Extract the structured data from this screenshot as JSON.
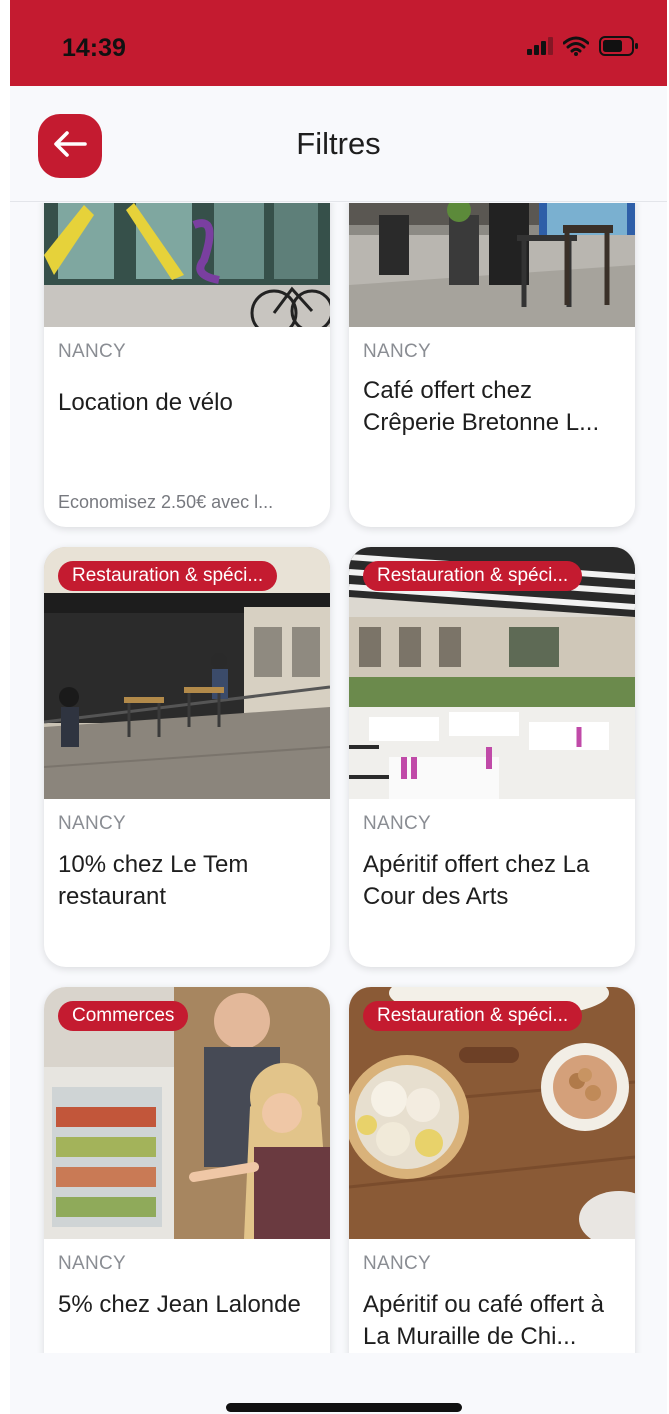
{
  "status_bar": {
    "time": "14:39",
    "icons": [
      "signal-icon",
      "wifi-icon",
      "battery-icon"
    ]
  },
  "header": {
    "title": "Filtres",
    "back_icon": "arrow-left-icon"
  },
  "colors": {
    "brand": "#c41b30",
    "background": "#f8f9fc",
    "card": "#ffffff",
    "title_text": "#1e1e1e",
    "muted_text": "#8a8d93"
  },
  "cards": [
    {
      "badge": "",
      "city": "NANCY",
      "title": "Location de vélo",
      "subtitle": "Economisez 2.50€ avec l..."
    },
    {
      "badge": "",
      "city": "NANCY",
      "title": "Café offert chez Crêperie Bretonne L...",
      "subtitle": ""
    },
    {
      "badge": "Restauration & spéci...",
      "city": "NANCY",
      "title": "10% chez Le Tem restaurant",
      "subtitle": ""
    },
    {
      "badge": "Restauration & spéci...",
      "city": "NANCY",
      "title": "Apéritif offert chez La Cour des Arts",
      "subtitle": ""
    },
    {
      "badge": "Commerces",
      "city": "NANCY",
      "title": "5% chez Jean Lalonde",
      "subtitle": ""
    },
    {
      "badge": "Restauration & spéci...",
      "city": "NANCY",
      "title": "Apéritif ou café offert à La Muraille de Chi...",
      "subtitle": ""
    }
  ]
}
